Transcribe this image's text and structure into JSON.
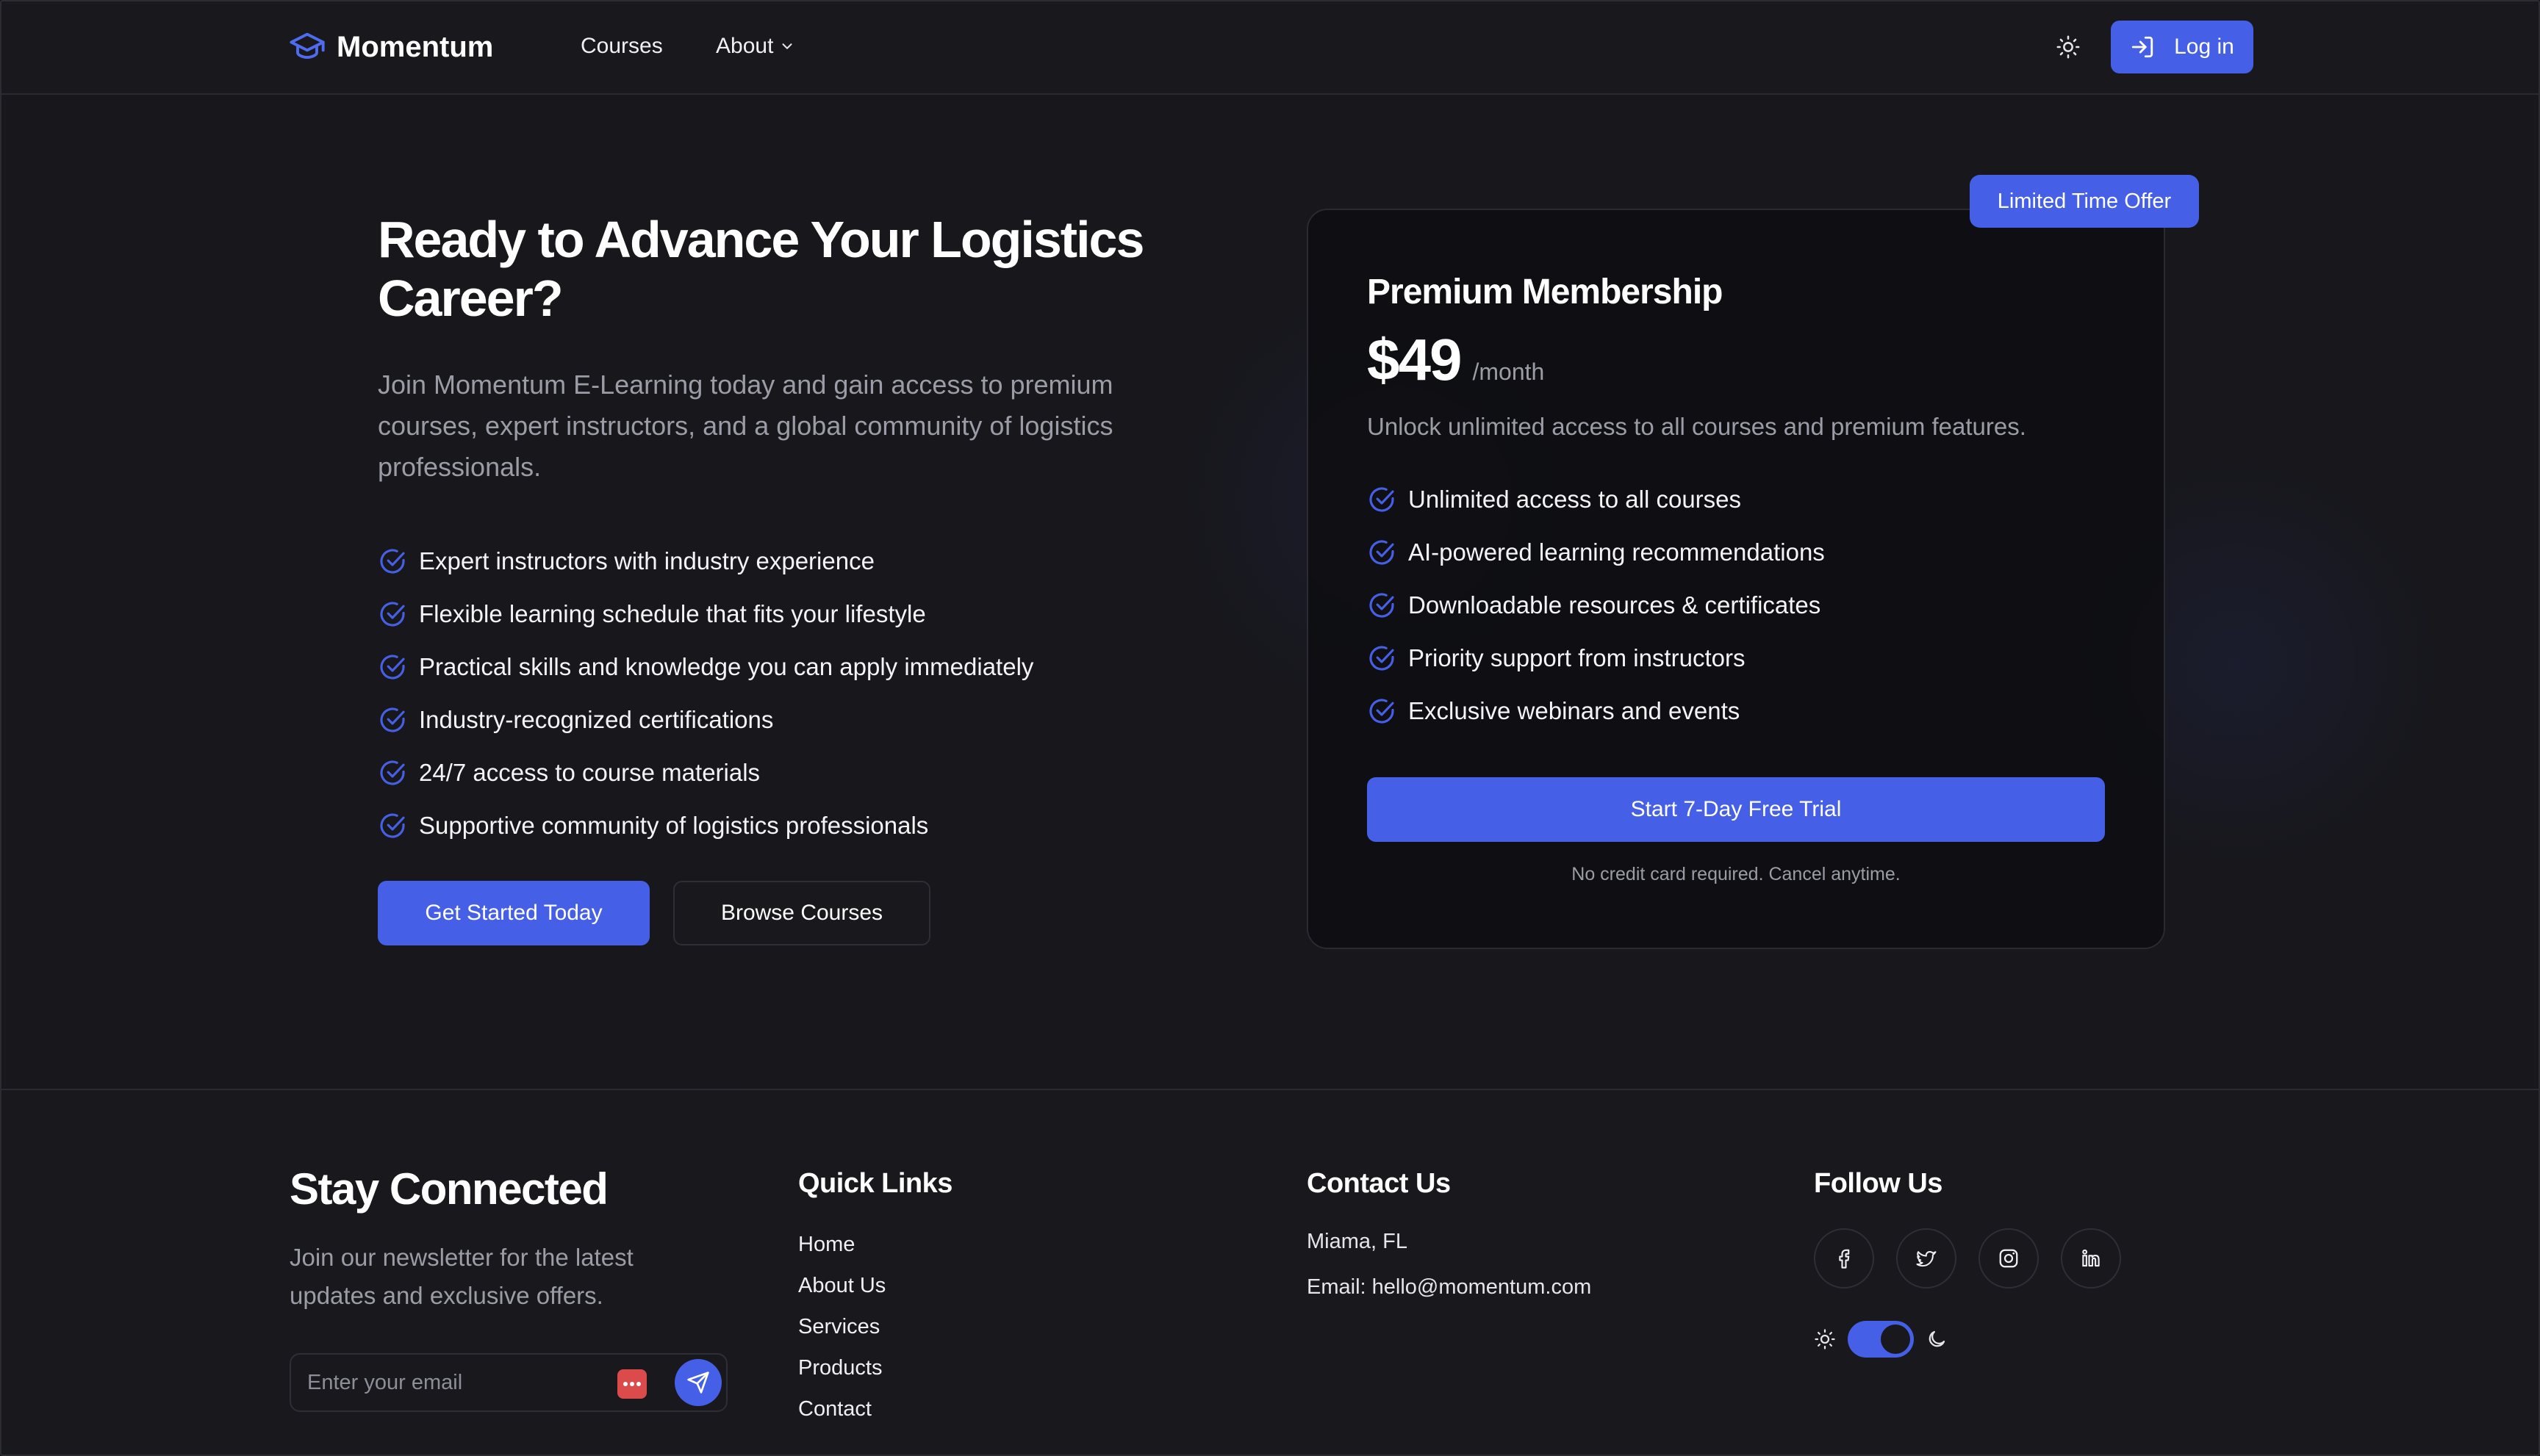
{
  "header": {
    "brand": "Momentum",
    "nav": {
      "courses": "Courses",
      "about": "About"
    },
    "login_label": "Log in"
  },
  "hero": {
    "title": "Ready to Advance Your Logistics Career?",
    "subtitle": "Join Momentum E-Learning today and gain access to premium courses, expert instructors, and a global community of logistics professionals.",
    "features": [
      "Expert instructors with industry experience",
      "Flexible learning schedule that fits your lifestyle",
      "Practical skills and knowledge you can apply immediately",
      "Industry-recognized certifications",
      "24/7 access to course materials",
      "Supportive community of logistics professionals"
    ],
    "primary_cta": "Get Started Today",
    "secondary_cta": "Browse Courses"
  },
  "pricing": {
    "badge": "Limited Time Offer",
    "title": "Premium Membership",
    "price": "$49",
    "period": "/month",
    "description": "Unlock unlimited access to all courses and premium features.",
    "features": [
      "Unlimited access to all courses",
      "AI-powered learning recommendations",
      "Downloadable resources & certificates",
      "Priority support from instructors",
      "Exclusive webinars and events"
    ],
    "cta": "Start 7-Day Free Trial",
    "note": "No credit card required. Cancel anytime."
  },
  "footer": {
    "newsletter": {
      "title": "Stay Connected",
      "text": "Join our newsletter for the latest updates and exclusive offers.",
      "placeholder": "Enter your email"
    },
    "quick_links": {
      "title": "Quick Links",
      "items": [
        "Home",
        "About Us",
        "Services",
        "Products",
        "Contact"
      ]
    },
    "contact": {
      "title": "Contact Us",
      "location": "Miama, FL",
      "email": "Email: hello@momentum.com"
    },
    "follow": {
      "title": "Follow Us",
      "networks": [
        "facebook-icon",
        "twitter-icon",
        "instagram-icon",
        "linkedin-icon"
      ],
      "dark_mode_on": true
    }
  },
  "colors": {
    "accent": "#4560e6",
    "background": "#17171c",
    "muted_text": "#9c9ca7",
    "password_badge": "#dc4b4b"
  }
}
